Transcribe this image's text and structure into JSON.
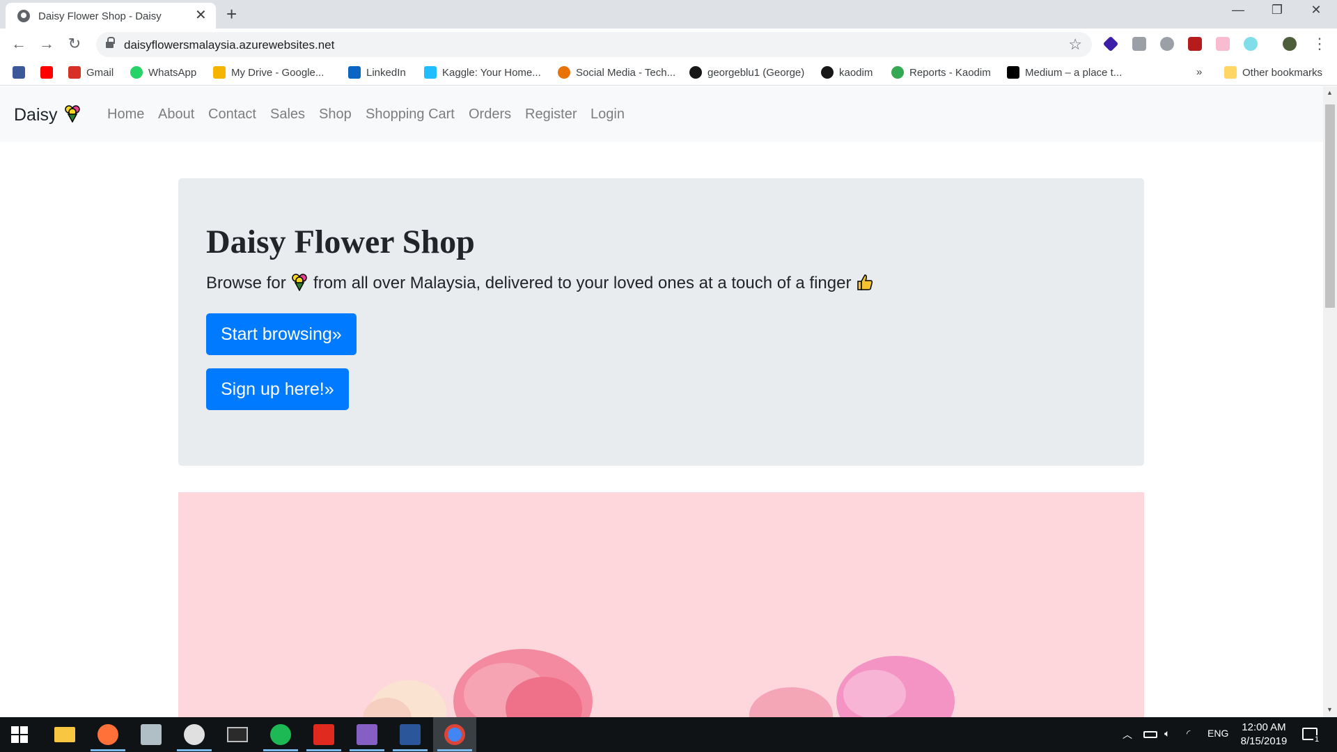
{
  "browser": {
    "tab_title": "Daisy Flower Shop - Daisy",
    "url": "daisyflowersmalaysia.azurewebsites.net",
    "bookmarks": [
      {
        "label": "",
        "icon": "facebook-icon",
        "color": "#3b5998"
      },
      {
        "label": "",
        "icon": "youtube-icon",
        "color": "#ff0000"
      },
      {
        "label": "Gmail",
        "icon": "gmail-icon",
        "color": "#d93025"
      },
      {
        "label": "WhatsApp",
        "icon": "whatsapp-icon",
        "color": "#25d366"
      },
      {
        "label": "My Drive - Google...",
        "icon": "google-drive-icon",
        "color": "#f4b400"
      },
      {
        "label": "LinkedIn",
        "icon": "linkedin-icon",
        "color": "#0a66c2"
      },
      {
        "label": "Kaggle: Your Home...",
        "icon": "kaggle-icon",
        "color": "#20beff"
      },
      {
        "label": "Social Media - Tech...",
        "icon": "social-media-icon",
        "color": "#e8710a"
      },
      {
        "label": "georgeblu1 (George)",
        "icon": "github-icon",
        "color": "#181717"
      },
      {
        "label": "kaodim",
        "icon": "github-icon",
        "color": "#181717"
      },
      {
        "label": "Reports - Kaodim",
        "icon": "kaodim-icon",
        "color": "#34a853"
      },
      {
        "label": "Medium – a place t...",
        "icon": "medium-icon",
        "color": "#000000"
      }
    ],
    "more_bookmarks": "»",
    "other_bookmarks": "Other bookmarks"
  },
  "site": {
    "brand": "Daisy",
    "nav": [
      "Home",
      "About",
      "Contact",
      "Sales",
      "Shop",
      "Shopping Cart",
      "Orders",
      "Register",
      "Login"
    ],
    "jumbotron": {
      "title": "Daisy Flower Shop",
      "lead_before": "Browse for",
      "lead_after": "from all over Malaysia, delivered to your loved ones at a touch of a finger",
      "btn_browse": "Start browsing»",
      "btn_signup": "Sign up here!»"
    },
    "colors": {
      "primary": "#007bff",
      "jumbotron_bg": "#e9ecef",
      "hero_bg": "#fdd7dc",
      "navbar_bg": "#f8f9fa"
    }
  },
  "taskbar": {
    "lang": "ENG",
    "time": "12:00 AM",
    "date": "8/15/2019",
    "notification_count": "1",
    "apps": [
      "windows-start-icon",
      "file-explorer-icon",
      "firefox-icon",
      "printer-icon",
      "paint-icon",
      "terminal-icon",
      "spotify-icon",
      "acrobat-icon",
      "visual-studio-icon",
      "word-icon",
      "chrome-icon"
    ]
  }
}
